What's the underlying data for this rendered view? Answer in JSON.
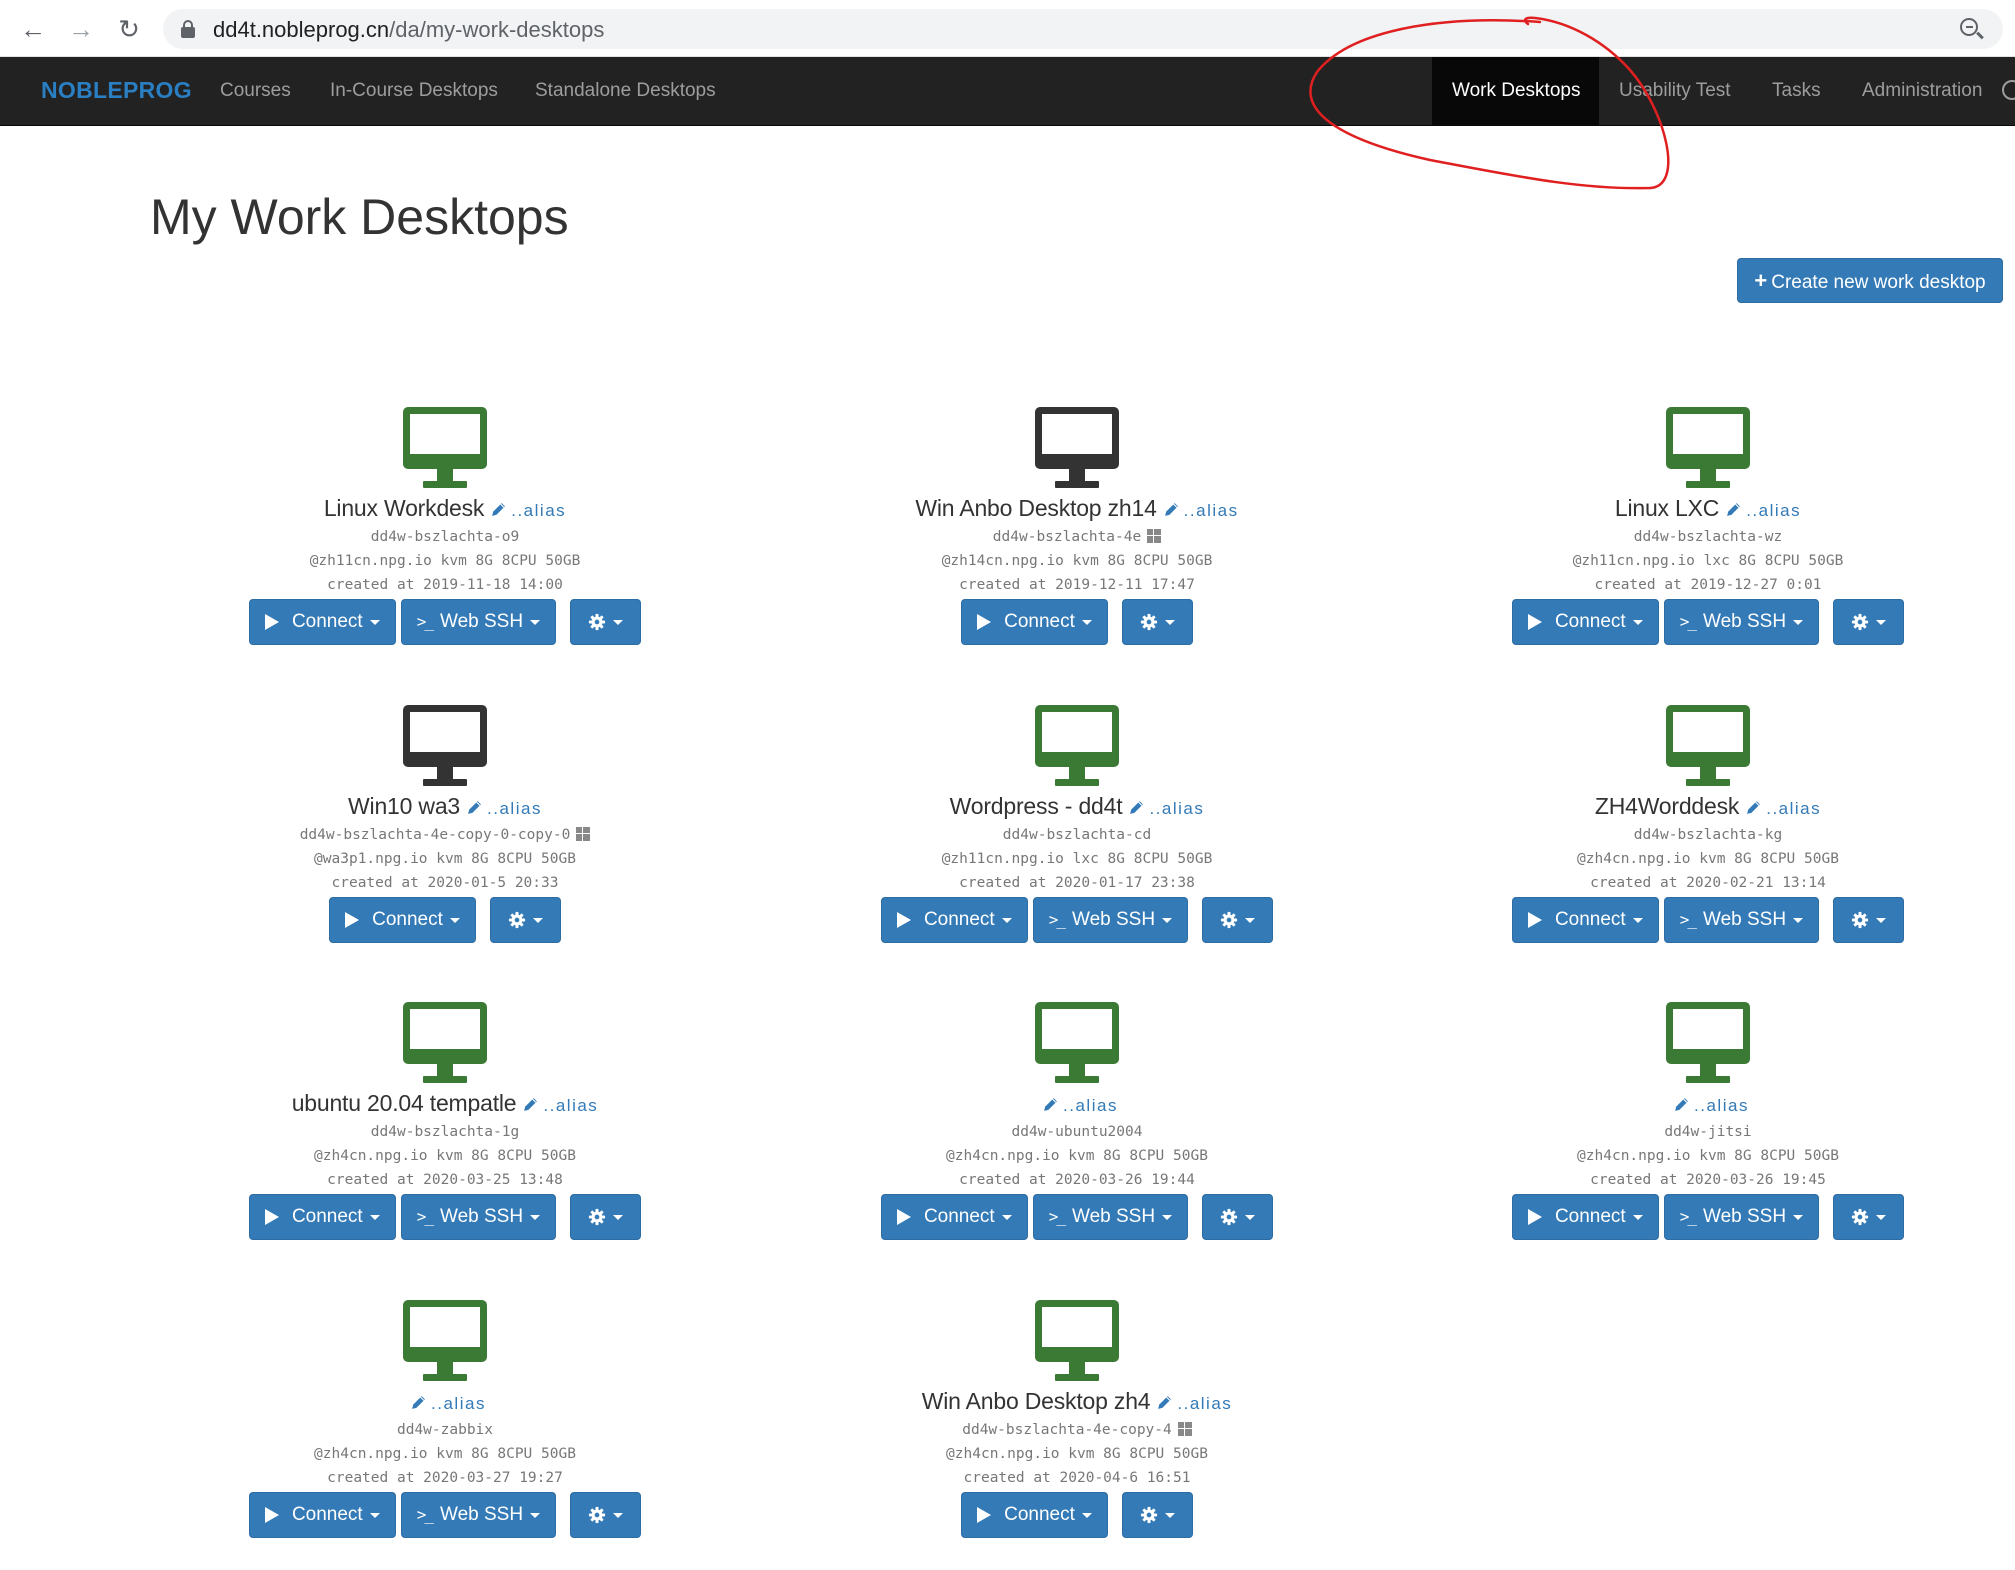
{
  "browser": {
    "url_host": "dd4t.nobleprog.cn",
    "url_path": "/da/my-work-desktops"
  },
  "navbar": {
    "brand": "NOBLEPROG",
    "items": [
      {
        "label": "Courses"
      },
      {
        "label": "In-Course Desktops"
      },
      {
        "label": "Standalone Desktops"
      },
      {
        "label": "Work Desktops"
      },
      {
        "label": "Usability Test"
      },
      {
        "label": "Tasks"
      },
      {
        "label": "Administration"
      }
    ],
    "active_item": "Work Desktops"
  },
  "page": {
    "title": "My Work Desktops",
    "create_button": "Create new work desktop"
  },
  "labels": {
    "alias": "..alias",
    "connect": "Connect",
    "web_ssh": "Web SSH",
    "prompt_glyph": ">_"
  },
  "colors": {
    "monitor_running": "#3b7a34",
    "monitor_stopped": "#333333",
    "primary": "#337ab7",
    "annotation": "#e02020"
  },
  "desktops": [
    {
      "name": "Linux Workdesk",
      "id": "dd4w-bszlachta-o9",
      "windows": false,
      "host": "@zh11cn.npg.io kvm 8G 8CPU 50GB",
      "created": "created at 2019-11-18 14:00",
      "status": "running",
      "web_ssh": true
    },
    {
      "name": "Win Anbo Desktop zh14",
      "id": "dd4w-bszlachta-4e",
      "windows": true,
      "host": "@zh14cn.npg.io kvm 8G 8CPU 50GB",
      "created": "created at 2019-12-11 17:47",
      "status": "stopped",
      "web_ssh": false
    },
    {
      "name": "Linux LXC",
      "id": "dd4w-bszlachta-wz",
      "windows": false,
      "host": "@zh11cn.npg.io lxc 8G 8CPU 50GB",
      "created": "created at 2019-12-27 0:01",
      "status": "running",
      "web_ssh": true
    },
    {
      "name": "Win10 wa3",
      "id": "dd4w-bszlachta-4e-copy-0-copy-0",
      "windows": true,
      "host": "@wa3p1.npg.io kvm 8G 8CPU 50GB",
      "created": "created at 2020-01-5 20:33",
      "status": "stopped",
      "web_ssh": false
    },
    {
      "name": "Wordpress - dd4t",
      "id": "dd4w-bszlachta-cd",
      "windows": false,
      "host": "@zh11cn.npg.io lxc 8G 8CPU 50GB",
      "created": "created at 2020-01-17 23:38",
      "status": "running",
      "web_ssh": true
    },
    {
      "name": "ZH4Worddesk",
      "id": "dd4w-bszlachta-kg",
      "windows": false,
      "host": "@zh4cn.npg.io kvm 8G 8CPU 50GB",
      "created": "created at 2020-02-21 13:14",
      "status": "running",
      "web_ssh": true
    },
    {
      "name": "ubuntu 20.04 tempatle",
      "id": "dd4w-bszlachta-1g",
      "windows": false,
      "host": "@zh4cn.npg.io kvm 8G 8CPU 50GB",
      "created": "created at 2020-03-25 13:48",
      "status": "running",
      "web_ssh": true
    },
    {
      "name": "",
      "id": "dd4w-ubuntu2004",
      "windows": false,
      "host": "@zh4cn.npg.io kvm 8G 8CPU 50GB",
      "created": "created at 2020-03-26 19:44",
      "status": "running",
      "web_ssh": true
    },
    {
      "name": "",
      "id": "dd4w-jitsi",
      "windows": false,
      "host": "@zh4cn.npg.io kvm 8G 8CPU 50GB",
      "created": "created at 2020-03-26 19:45",
      "status": "running",
      "web_ssh": true
    },
    {
      "name": "",
      "id": "dd4w-zabbix",
      "windows": false,
      "host": "@zh4cn.npg.io kvm 8G 8CPU 50GB",
      "created": "created at 2020-03-27 19:27",
      "status": "running",
      "web_ssh": true
    },
    {
      "name": "Win Anbo Desktop zh4",
      "id": "dd4w-bszlachta-4e-copy-4",
      "windows": true,
      "host": "@zh4cn.npg.io kvm 8G 8CPU 50GB",
      "created": "created at 2020-04-6 16:51",
      "status": "running",
      "web_ssh": false
    }
  ]
}
